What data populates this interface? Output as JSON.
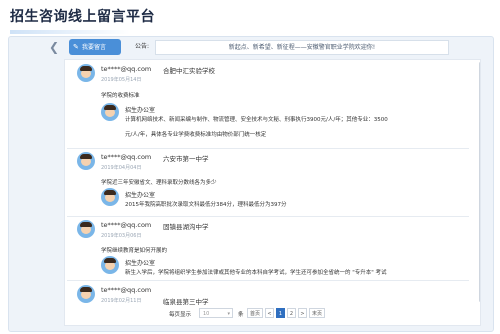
{
  "app": {
    "title": "招生咨询线上留言平台"
  },
  "toolbar": {
    "back_icon": "chevron-left-icon",
    "message_button": "我要留言",
    "message_icon": "pen-icon",
    "notice_label": "公告:",
    "notice_text": "新起点、新希望、新征程——安徽警官职业学院欢迎你!"
  },
  "entries": [
    {
      "user": "te****@qq.com",
      "school": "合肥中汇实验学校",
      "date": "2019年05月14日",
      "question": "学院的收费标准",
      "reply_name": "招生办公室",
      "reply_lines": [
        "计算机网络技术、新闻采编与制作、物流管理、安全技术与文秘、刑事执行3900元/人/年；其他专业：3500",
        "元/人/年，具体各专业学费收费标准均由物价部门统一核定"
      ]
    },
    {
      "user": "te****@qq.com",
      "school": "六安市第一中学",
      "date": "2019年04月04日",
      "question": "学院近三年安徽省文、理科录取分数线各为多少",
      "reply_name": "招生办公室",
      "reply_lines": [
        "2015年我院高职批次录取文科最低分384分，理科最低分为397分"
      ]
    },
    {
      "user": "te****@qq.com",
      "school": "固镇县湖沟中学",
      "date": "2019年03月06日",
      "question": "学院继续教育是如何开展的",
      "reply_name": "招生办公室",
      "reply_lines": [
        "新生入学后，学院将组织学生参加法律或其他专业的本科自学考试，学生还可参加全省统一的 \"专升本\" 考试"
      ]
    },
    {
      "user": "te****@qq.com",
      "school": "临泉县第三中学",
      "date": "2019年02月11日",
      "question": "",
      "reply_name": "",
      "reply_lines": []
    }
  ],
  "pager": {
    "per_page_label": "每页显示",
    "per_page_value": "10",
    "items_label": "条",
    "first_label": "首页",
    "prev_label": "<",
    "pages": [
      "1",
      "2"
    ],
    "current_page": "1",
    "next_label": ">",
    "last_label": "末页"
  }
}
